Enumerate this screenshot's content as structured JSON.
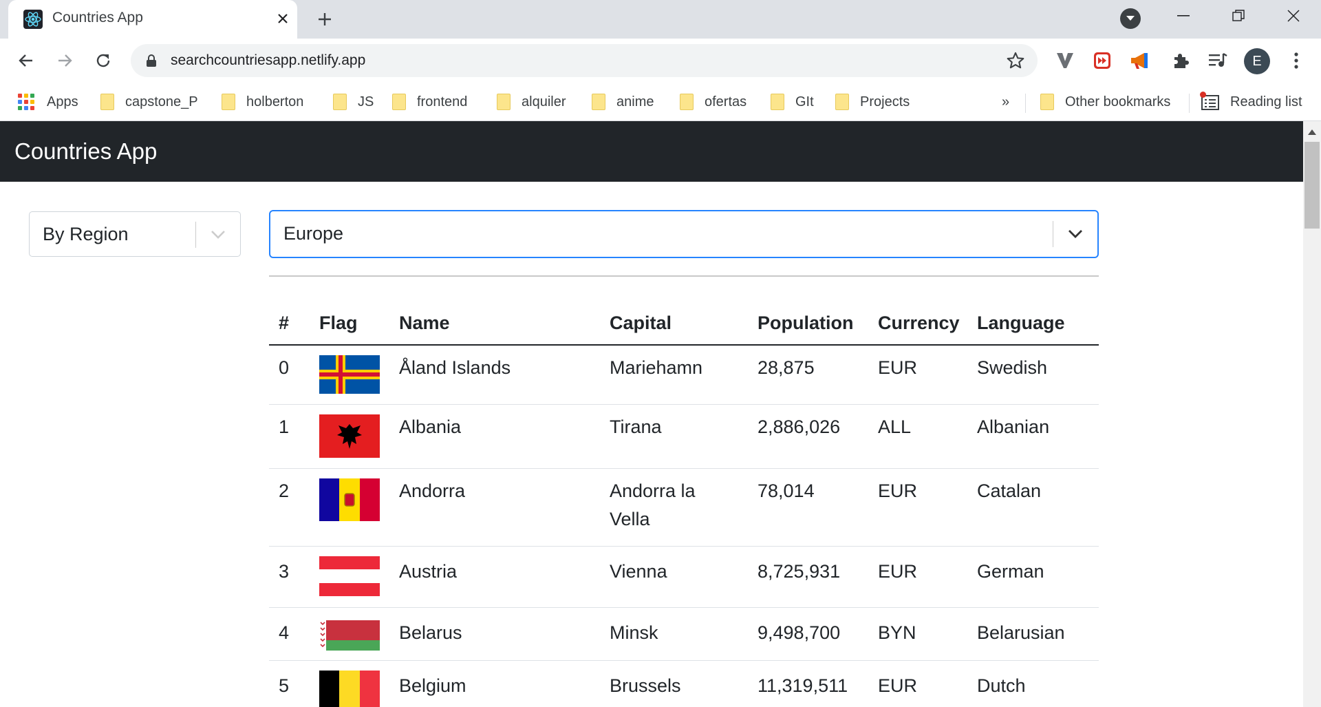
{
  "browser": {
    "tab_title": "Countries App",
    "url": "searchcountriesapp.netlify.app",
    "profile_initial": "E",
    "bookmarks": [
      "Apps",
      "capstone_P",
      "holberton",
      "JS",
      "frontend",
      "alquiler",
      "anime",
      "ofertas",
      "GIt",
      "Projects"
    ],
    "overflow": "»",
    "other_bookmarks": "Other bookmarks",
    "reading_list": "Reading list"
  },
  "app": {
    "brand": "Countries App",
    "filter_type": "By Region",
    "region": "Europe"
  },
  "table": {
    "headers": [
      "#",
      "Flag",
      "Name",
      "Capital",
      "Population",
      "Currency",
      "Language"
    ],
    "rows": [
      {
        "idx": "0",
        "flag": "Åland Islands flag",
        "name": "Åland Islands",
        "capital": "Mariehamn",
        "population": "28,875",
        "currency": "EUR",
        "language": "Swedish"
      },
      {
        "idx": "1",
        "flag": "Albania flag",
        "name": "Albania",
        "capital": "Tirana",
        "population": "2,886,026",
        "currency": "ALL",
        "language": "Albanian"
      },
      {
        "idx": "2",
        "flag": "Andorra flag",
        "name": "Andorra",
        "capital": "Andorra la Vella",
        "population": "78,014",
        "currency": "EUR",
        "language": "Catalan"
      },
      {
        "idx": "3",
        "flag": "Austria flag",
        "name": "Austria",
        "capital": "Vienna",
        "population": "8,725,931",
        "currency": "EUR",
        "language": "German"
      },
      {
        "idx": "4",
        "flag": "Belarus flag",
        "name": "Belarus",
        "capital": "Minsk",
        "population": "9,498,700",
        "currency": "BYN",
        "language": "Belarusian"
      },
      {
        "idx": "5",
        "flag": "Belgium flag",
        "name": "Belgium",
        "capital": "Brussels",
        "population": "11,319,511",
        "currency": "EUR",
        "language": "Dutch"
      }
    ]
  },
  "colors": {
    "navbar": "#212529",
    "select_focus": "#2684ff",
    "tabstrip": "#dee1e6"
  }
}
